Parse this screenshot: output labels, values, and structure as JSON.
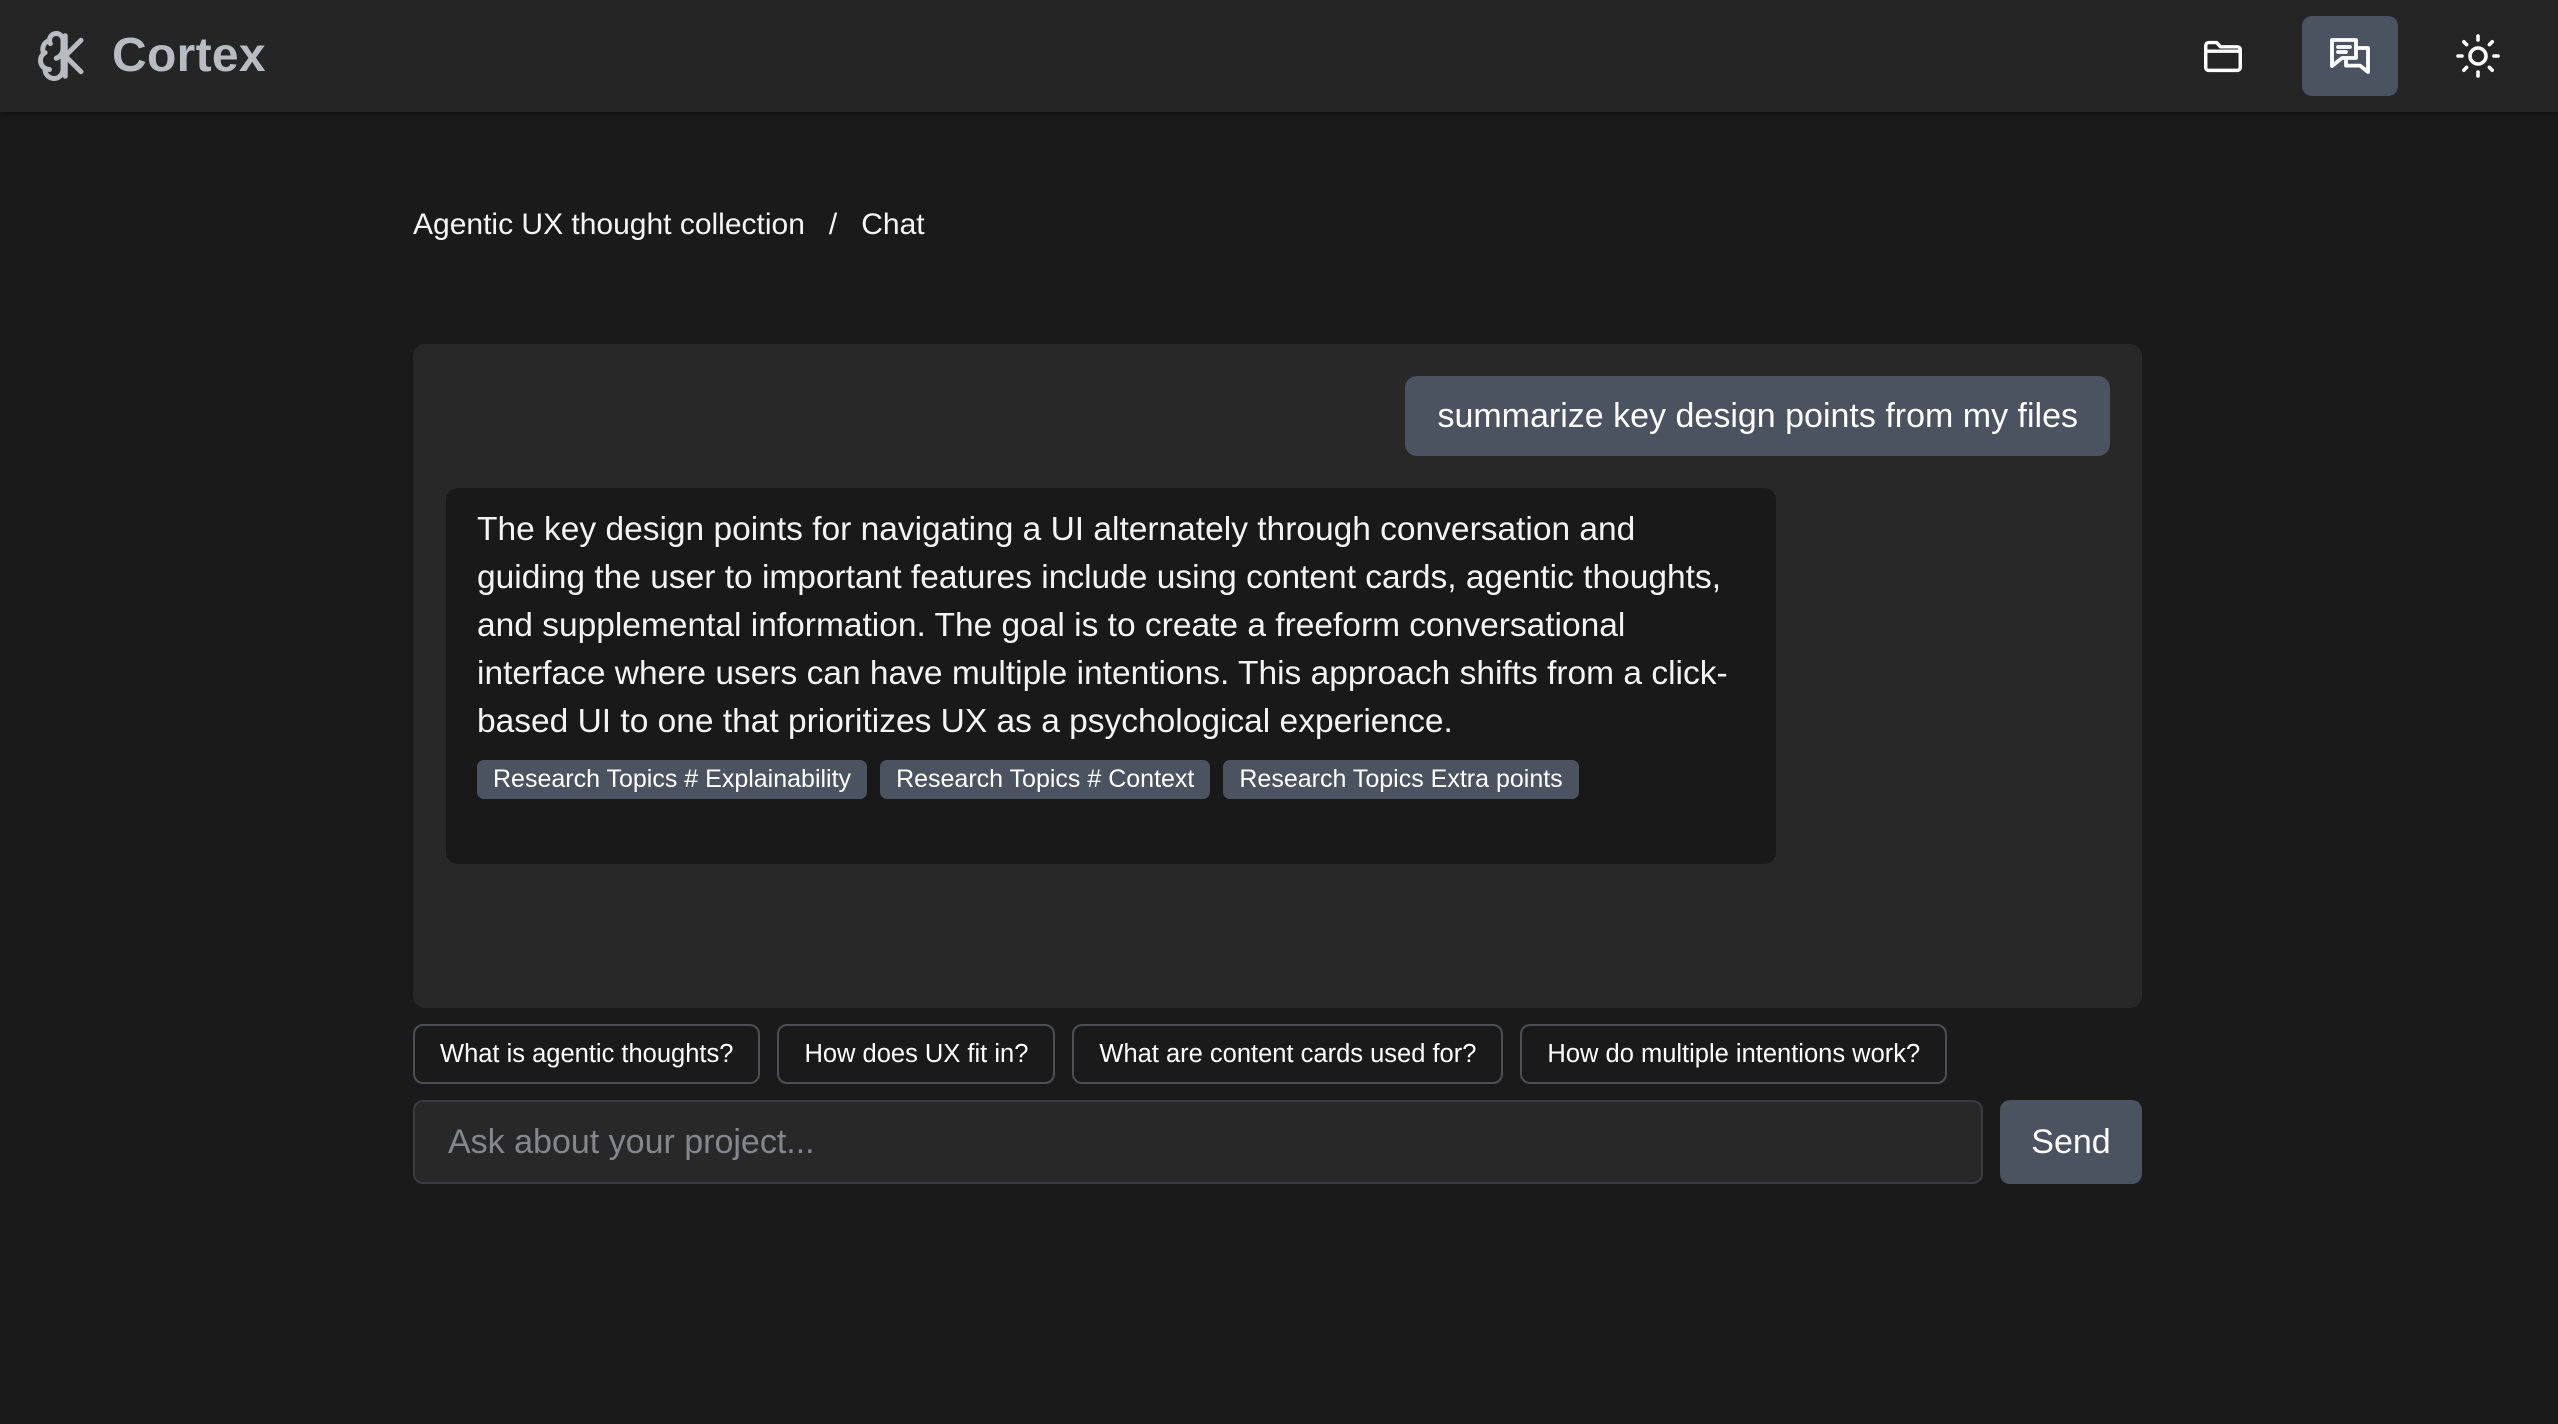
{
  "app": {
    "name": "Cortex",
    "logo_icon": "brain-icon"
  },
  "header": {
    "buttons": [
      {
        "icon": "folder-icon",
        "active": false
      },
      {
        "icon": "chat-icon",
        "active": true
      },
      {
        "icon": "sun-icon",
        "active": false
      }
    ]
  },
  "breadcrumb": {
    "project": "Agentic UX thought collection",
    "separator": "/",
    "current": "Chat"
  },
  "chat": {
    "messages": [
      {
        "role": "user",
        "text": "summarize key design points from my files"
      },
      {
        "role": "assistant",
        "text": "The key design points for navigating a UI alternately through conversation and guiding the user to important features include using content cards, agentic thoughts, and supplemental information. The goal is to create a freeform conversational interface where users can have multiple intentions. This approach shifts from a click-based UI to one that prioritizes UX as a psychological experience.",
        "sources": [
          "Research Topics # Explainability",
          "Research Topics # Context",
          "Research Topics Extra points"
        ]
      }
    ]
  },
  "suggestions": [
    "What is agentic thoughts?",
    "How does UX fit in?",
    "What are content cards used for?",
    "How do multiple intentions work?"
  ],
  "composer": {
    "placeholder": "Ask about your project...",
    "value": "",
    "send_label": "Send"
  },
  "colors": {
    "background": "#1a1a1b",
    "topbar": "#252526",
    "panel": "#282829",
    "accent": "#4b5260",
    "brand_text": "#b8bcc2"
  }
}
